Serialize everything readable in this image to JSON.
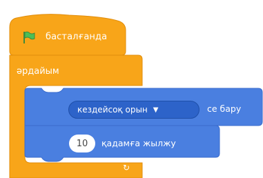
{
  "hat_block": {
    "label": "басталғанда",
    "icon": "green-flag-icon",
    "color": "#f8a519"
  },
  "forever_block": {
    "label": "әрдайым",
    "color": "#f8a519",
    "loop_icon": "↻"
  },
  "motion_block_1": {
    "dropdown_label": "кездейсоқ орын",
    "dropdown_arrow": "▼",
    "suffix": "се бару",
    "color": "#4a7fe0"
  },
  "motion_block_2": {
    "input_value": "10",
    "label": "қадамға жылжу",
    "color": "#4a7fe0"
  }
}
